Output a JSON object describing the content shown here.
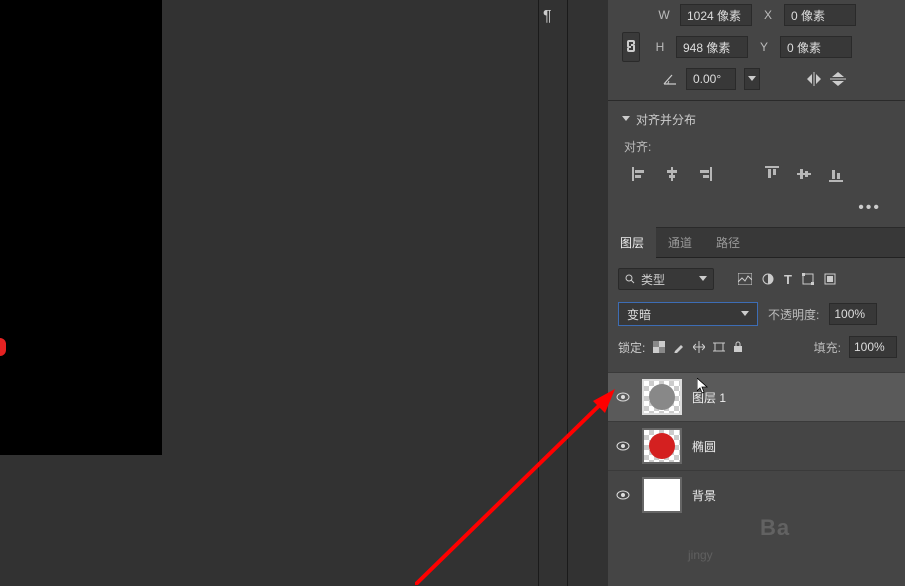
{
  "transform": {
    "w_label": "W",
    "w_value": "1024 像素",
    "h_label": "H",
    "h_value": "948 像素",
    "x_label": "X",
    "x_value": "0 像素",
    "y_label": "Y",
    "y_value": "0 像素",
    "angle_value": "0.00°"
  },
  "align": {
    "header": "对齐并分布",
    "label": "对齐:"
  },
  "layers": {
    "tabs": [
      "图层",
      "通道",
      "路径"
    ],
    "filter_type": "类型",
    "blend_mode": "变暗",
    "opacity_label": "不透明度:",
    "opacity_value": "100%",
    "lock_label": "锁定:",
    "fill_label": "填充:",
    "fill_value": "100%",
    "items": [
      {
        "name": "图层 1"
      },
      {
        "name": "椭圆"
      },
      {
        "name": "背景"
      }
    ]
  },
  "watermark": {
    "text1": "Ba",
    "text2": "jingy"
  }
}
